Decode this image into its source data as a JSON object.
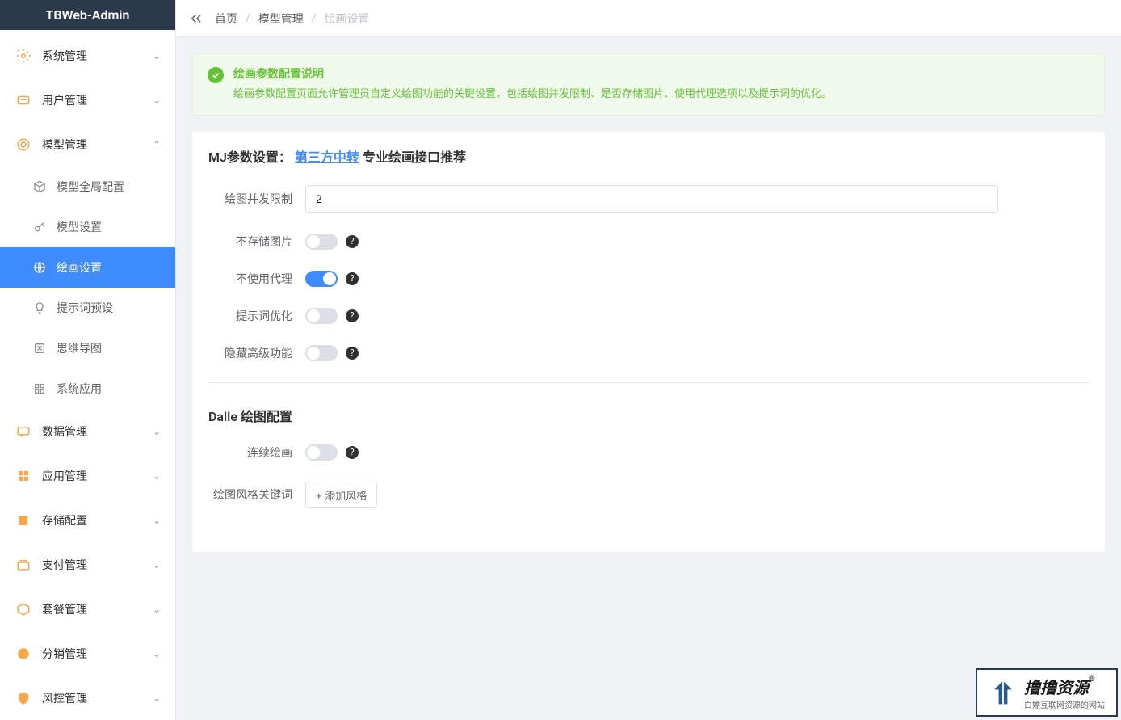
{
  "app": {
    "title": "TBWeb-Admin"
  },
  "breadcrumb": {
    "items": [
      "首页",
      "模型管理",
      "绘画设置"
    ]
  },
  "sidebar": {
    "items": [
      {
        "label": "系统管理",
        "expanded": false
      },
      {
        "label": "用户管理",
        "expanded": false
      },
      {
        "label": "模型管理",
        "expanded": true
      },
      {
        "label": "数据管理",
        "expanded": false
      },
      {
        "label": "应用管理",
        "expanded": false
      },
      {
        "label": "存储配置",
        "expanded": false
      },
      {
        "label": "支付管理",
        "expanded": false
      },
      {
        "label": "套餐管理",
        "expanded": false
      },
      {
        "label": "分销管理",
        "expanded": false
      },
      {
        "label": "风控管理",
        "expanded": false
      }
    ],
    "submenu": [
      {
        "label": "模型全局配置"
      },
      {
        "label": "模型设置"
      },
      {
        "label": "绘画设置"
      },
      {
        "label": "提示词预设"
      },
      {
        "label": "思维导图"
      },
      {
        "label": "系统应用"
      }
    ]
  },
  "alert": {
    "title": "绘画参数配置说明",
    "desc": "绘画参数配置页面允许管理员自定义绘图功能的关键设置，包括绘图并发限制、是否存储图片、使用代理选项以及提示词的优化。"
  },
  "mj": {
    "title_prefix": "MJ参数设置：",
    "link": "第三方中转",
    "title_suffix": " 专业绘画接口推荐",
    "fields": {
      "concurrency_label": "绘图并发限制",
      "concurrency_value": "2",
      "no_store_label": "不存储图片",
      "no_proxy_label": "不使用代理",
      "prompt_opt_label": "提示词优化",
      "hide_advanced_label": "隐藏高级功能"
    }
  },
  "dalle": {
    "title": "Dalle 绘图配置",
    "fields": {
      "continuous_label": "连续绘画",
      "style_label": "绘图风格关键词",
      "add_style_btn": "+ 添加风格"
    }
  },
  "watermark": {
    "title": "撸撸资源",
    "reg": "®",
    "sub": "白嫖互联网资源的网站"
  }
}
